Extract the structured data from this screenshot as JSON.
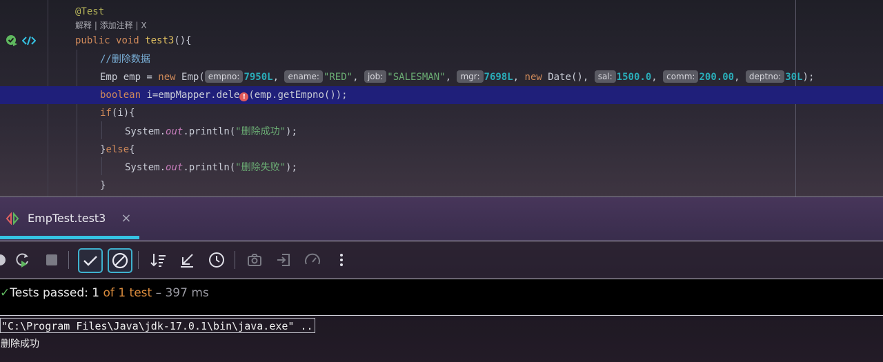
{
  "editor": {
    "codelens": "解释 | 添加注释 | X",
    "annotation": "@Test",
    "method": {
      "kw_public": "public",
      "kw_void": "void",
      "name": "test3",
      "rest": "(){"
    },
    "comment": "//删除数据",
    "emp_line": {
      "decl": "Emp emp = ",
      "kw_new": "new",
      "ctor": " Emp(",
      "args": [
        {
          "hint": "empno:",
          "value": "7950L",
          "type": "num"
        },
        {
          "hint": "ename:",
          "value": "\"RED\"",
          "type": "str"
        },
        {
          "hint": "job:",
          "value": "\"SALESMAN\"",
          "type": "str"
        },
        {
          "hint": "mgr:",
          "value": "7698L",
          "type": "num"
        },
        {
          "hint": "",
          "value": "new Date()",
          "type": "kw"
        },
        {
          "hint": "sal:",
          "value": "1500.0",
          "type": "num"
        },
        {
          "hint": "comm:",
          "value": "200.00",
          "type": "num"
        },
        {
          "hint": "deptno:",
          "value": "30L",
          "type": "num"
        }
      ],
      "end": ");"
    },
    "delete_line": {
      "kw_boolean": "boolean",
      "lhs": " i=empMapper.dele",
      "rhs": "(emp.getEmpno());"
    },
    "if_line": {
      "kw_if": "if",
      "rest": "(i){"
    },
    "println1": {
      "obj": "System.",
      "field": "out",
      "call": ".println(",
      "str": "\"删除成功\"",
      "end": ");"
    },
    "else_line": {
      "close": "}",
      "kw_else": "else",
      "open": "{"
    },
    "println2": {
      "obj": "System.",
      "field": "out",
      "call": ".println(",
      "str": "\"删除失败\"",
      "end": ");"
    },
    "close_brace": "}"
  },
  "run_panel": {
    "tab_title": "EmpTest.test3",
    "tab_close": "×",
    "status": {
      "prefix": "Tests passed: ",
      "passed": "1",
      "middle": " of 1 test",
      "duration": " – 397 ms"
    },
    "command": "\"C:\\Program Files\\Java\\jdk-17.0.1\\bin\\java.exe\" ...",
    "output": "删除成功"
  },
  "colors": {
    "accent": "#35c3e3",
    "highlight_line": "#1f1f7a",
    "pass_green": "#5fb85f",
    "orange": "#d88a3c"
  },
  "icons": [
    "run-icon",
    "rerun-failed-icon",
    "stop-icon",
    "show-passed-icon",
    "show-ignored-icon",
    "sort-icon",
    "collapse-icon",
    "history-icon",
    "screenshot-icon",
    "import-icon",
    "coverage-icon",
    "more-icon"
  ]
}
